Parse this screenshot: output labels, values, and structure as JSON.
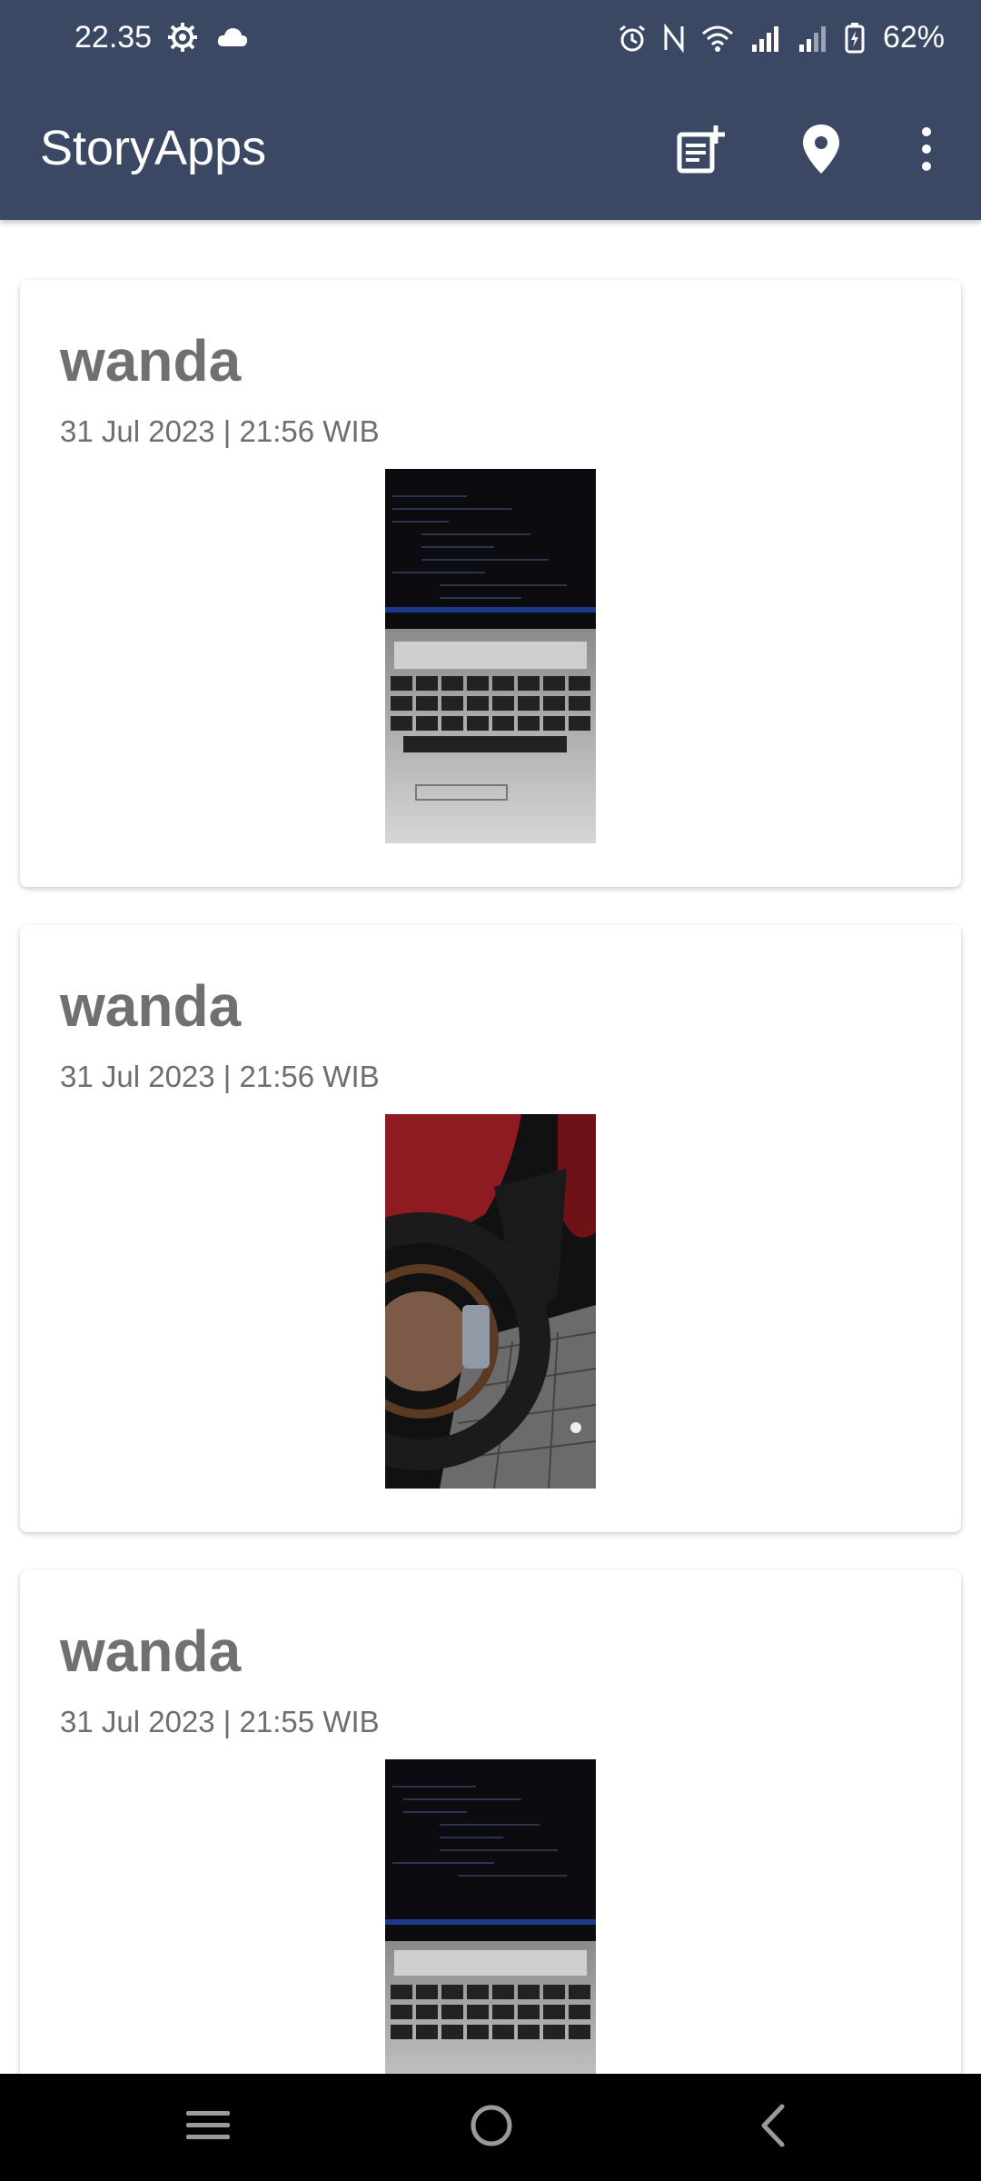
{
  "status_bar": {
    "time": "22.35",
    "left_icons": [
      "settings-gear-icon",
      "cloud-icon"
    ],
    "right_icons": [
      "alarm-icon",
      "nfc-icon",
      "wifi-icon",
      "signal-icon",
      "signal-icon",
      "battery-charging-icon"
    ],
    "battery": "62%"
  },
  "app_bar": {
    "title": "StoryApps",
    "actions": [
      "add-story-icon",
      "location-pin-icon",
      "more-vert-icon"
    ]
  },
  "stories": [
    {
      "name": "wanda",
      "date": "31 Jul 2023 | 21:56 WIB",
      "photo": "laptop-keyboard"
    },
    {
      "name": "wanda",
      "date": "31 Jul 2023 | 21:56 WIB",
      "photo": "motorcycle-wheel"
    },
    {
      "name": "wanda",
      "date": "31 Jul 2023 | 21:55 WIB",
      "photo": "laptop-keyboard"
    }
  ],
  "nav_bar": [
    "recent-apps-icon",
    "home-icon",
    "back-icon"
  ],
  "colors": {
    "app_bar": "#3a4864",
    "name_text": "#707070",
    "date_text": "#6e6e6e"
  }
}
